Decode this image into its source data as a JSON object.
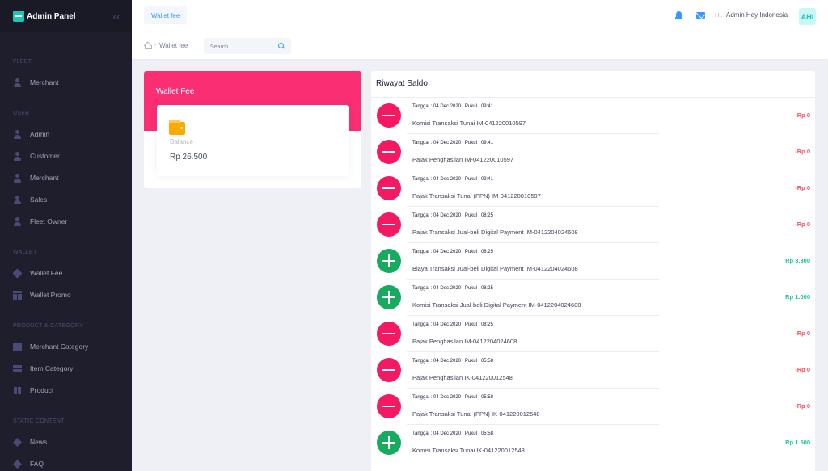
{
  "brand": {
    "title": "Admin Panel"
  },
  "sidebar": {
    "sections": [
      {
        "title": "FLEET",
        "items": [
          {
            "label": "Merchant",
            "icon": "user-icon"
          }
        ]
      },
      {
        "title": "USER",
        "items": [
          {
            "label": "Admin",
            "icon": "user-icon"
          },
          {
            "label": "Customer",
            "icon": "user-icon"
          },
          {
            "label": "Merchant",
            "icon": "user-icon"
          },
          {
            "label": "Sales",
            "icon": "user-icon"
          },
          {
            "label": "Fleet Owner",
            "icon": "user-icon"
          }
        ]
      },
      {
        "title": "WALLET",
        "items": [
          {
            "label": "Wallet Fee",
            "icon": "tag-icon"
          },
          {
            "label": "Wallet Promo",
            "icon": "grid-icon"
          }
        ]
      },
      {
        "title": "PRODUCT & CATEGORY",
        "items": [
          {
            "label": "Merchant Category",
            "icon": "layers-icon"
          },
          {
            "label": "Item Category",
            "icon": "layers-icon"
          },
          {
            "label": "Product",
            "icon": "book-icon"
          }
        ]
      },
      {
        "title": "STATIC CONTENT",
        "items": [
          {
            "label": "News",
            "icon": "diamond-icon"
          },
          {
            "label": "FAQ",
            "icon": "diamond-icon"
          }
        ]
      }
    ]
  },
  "topbar": {
    "tab": "Wallet fee",
    "greeting": "Hi,",
    "user_name": "Admin Hey Indonesia",
    "avatar_initials": "AHI"
  },
  "subheader": {
    "breadcrumb": "Wallet fee",
    "search_placeholder": "Search..."
  },
  "wallet": {
    "title": "Wallet Fee",
    "balance_label": "Balance",
    "balance_value": "Rp 26.500"
  },
  "history": {
    "title": "Riwayat Saldo",
    "transactions": [
      {
        "type": "out",
        "date": "Tanggal : 04 Dec 2020 | Pukul : 09:41",
        "desc": "Komisi Transaksi Tunai IM-041220010597",
        "amount": "-Rp 0"
      },
      {
        "type": "out",
        "date": "Tanggal : 04 Dec 2020 | Pukul : 09:41",
        "desc": "Pajak Penghasilan IM-041220010597",
        "amount": "-Rp 0"
      },
      {
        "type": "out",
        "date": "Tanggal : 04 Dec 2020 | Pukul : 09:41",
        "desc": "Pajak Transaksi Tunai (PPN) IM-041220010597",
        "amount": "-Rp 0"
      },
      {
        "type": "out",
        "date": "Tanggal : 04 Dec 2020 | Pukul : 08:25",
        "desc": "Pajak Transaksi Jual-beli Digital Payment IM-0412204024608",
        "amount": "-Rp 0"
      },
      {
        "type": "in",
        "date": "Tanggal : 04 Dec 2020 | Pukul : 08:25",
        "desc": "Biaya Transaksi Jual-beli Digital Payment IM-0412204024608",
        "amount": "Rp 3.300"
      },
      {
        "type": "in",
        "date": "Tanggal : 04 Dec 2020 | Pukul : 08:25",
        "desc": "Komisi Transaksi Jual-beli Digital Payment IM-0412204024608",
        "amount": "Rp 1.000"
      },
      {
        "type": "out",
        "date": "Tanggal : 04 Dec 2020 | Pukul : 08:25",
        "desc": "Pajak Penghasilan IM-0412204024608",
        "amount": "-Rp 0"
      },
      {
        "type": "out",
        "date": "Tanggal : 04 Dec 2020 | Pukul : 05:58",
        "desc": "Pajak Penghasilan IK-041220012548",
        "amount": "-Rp 0"
      },
      {
        "type": "out",
        "date": "Tanggal : 04 Dec 2020 | Pukul : 05:58",
        "desc": "Pajak Transaksi Tunai (PPN) IK-041220012548",
        "amount": "-Rp 0"
      },
      {
        "type": "in",
        "date": "Tanggal : 04 Dec 2020 | Pukul : 05:58",
        "desc": "Komisi Transaksi Tunai IK-041220012548",
        "amount": "Rp 1.500"
      }
    ]
  },
  "colors": {
    "sidebar_bg": "#1e1e2d",
    "primary": "#3699ff",
    "wallet_header": "#fa2e72",
    "debit": "#f51863",
    "credit": "#17ab60"
  }
}
